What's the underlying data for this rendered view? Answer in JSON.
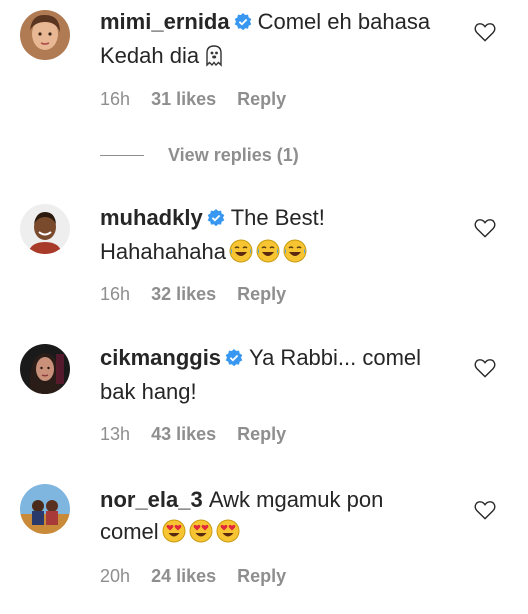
{
  "comments": [
    {
      "username": "mimi_ernida",
      "verified": true,
      "text_line1": "Comel eh bahasa",
      "text_line2": "Kedah dia",
      "emoji": "ghost",
      "emoji_count": 1,
      "time": "16h",
      "likes": "31 likes",
      "reply": "Reply"
    },
    {
      "username": "muhadkly",
      "verified": true,
      "text_line1": "The Best!",
      "text_line2": "Hahahahaha",
      "emoji": "tears-of-joy",
      "emoji_count": 3,
      "time": "16h",
      "likes": "32 likes",
      "reply": "Reply"
    },
    {
      "username": "cikmanggis",
      "verified": true,
      "text_line1": "Ya Rabbi... comel",
      "text_line2": "bak hang!",
      "time": "13h",
      "likes": "43 likes",
      "reply": "Reply"
    },
    {
      "username": "nor_ela_3",
      "verified": false,
      "text_line1": "Awk mgamuk pon",
      "text_line2": "comel",
      "emoji": "heart-eyes",
      "emoji_count": 3,
      "time": "20h",
      "likes": "24 likes",
      "reply": "Reply"
    }
  ],
  "view_replies": "View replies (1)",
  "colors": {
    "text": "#262626",
    "meta": "#8e8e8e",
    "verified": "#3897f0",
    "emoji_face": "#f7c531"
  }
}
